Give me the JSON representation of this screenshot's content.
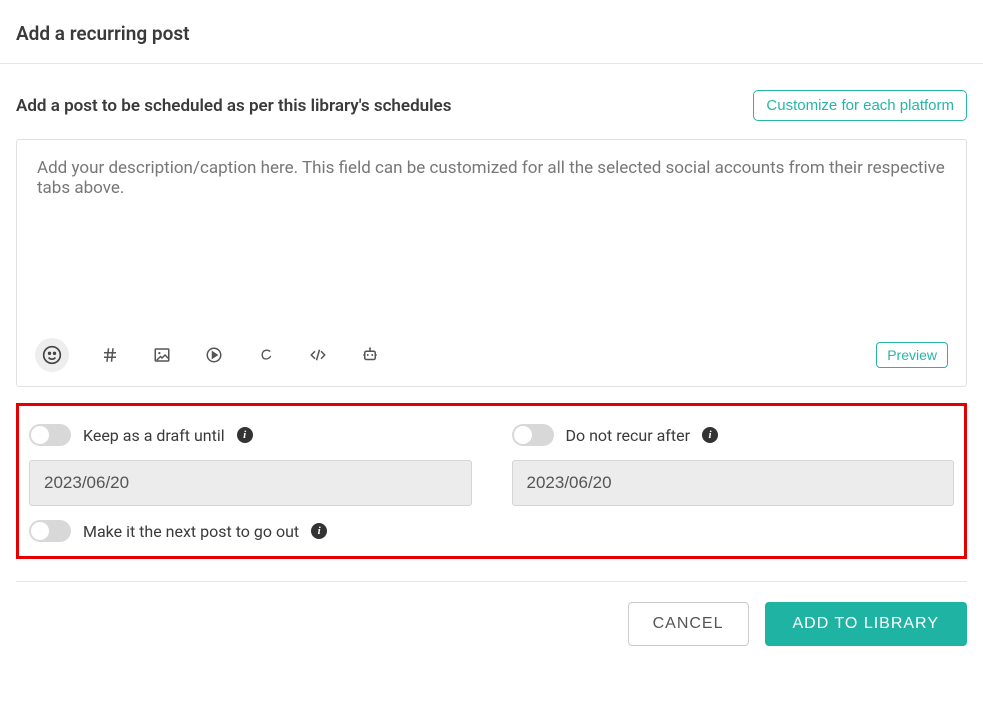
{
  "header": {
    "title": "Add a recurring post"
  },
  "subheader": {
    "text": "Add a post to be scheduled as per this library's schedules",
    "customize_btn": "Customize for each platform"
  },
  "editor": {
    "placeholder": "Add your description/caption here. This field can be customized for all the selected social accounts from their respective tabs above.",
    "preview_btn": "Preview"
  },
  "options": {
    "draft": {
      "label": "Keep as a draft until",
      "date": "2023/06/20",
      "enabled": false
    },
    "norecur": {
      "label": "Do not recur after",
      "date": "2023/06/20",
      "enabled": false
    },
    "nextpost": {
      "label": "Make it the next post to go out",
      "enabled": false
    }
  },
  "footer": {
    "cancel": "CANCEL",
    "submit": "ADD TO LIBRARY"
  },
  "colors": {
    "teal": "#1fb3a4",
    "highlight_border": "#e40000"
  }
}
